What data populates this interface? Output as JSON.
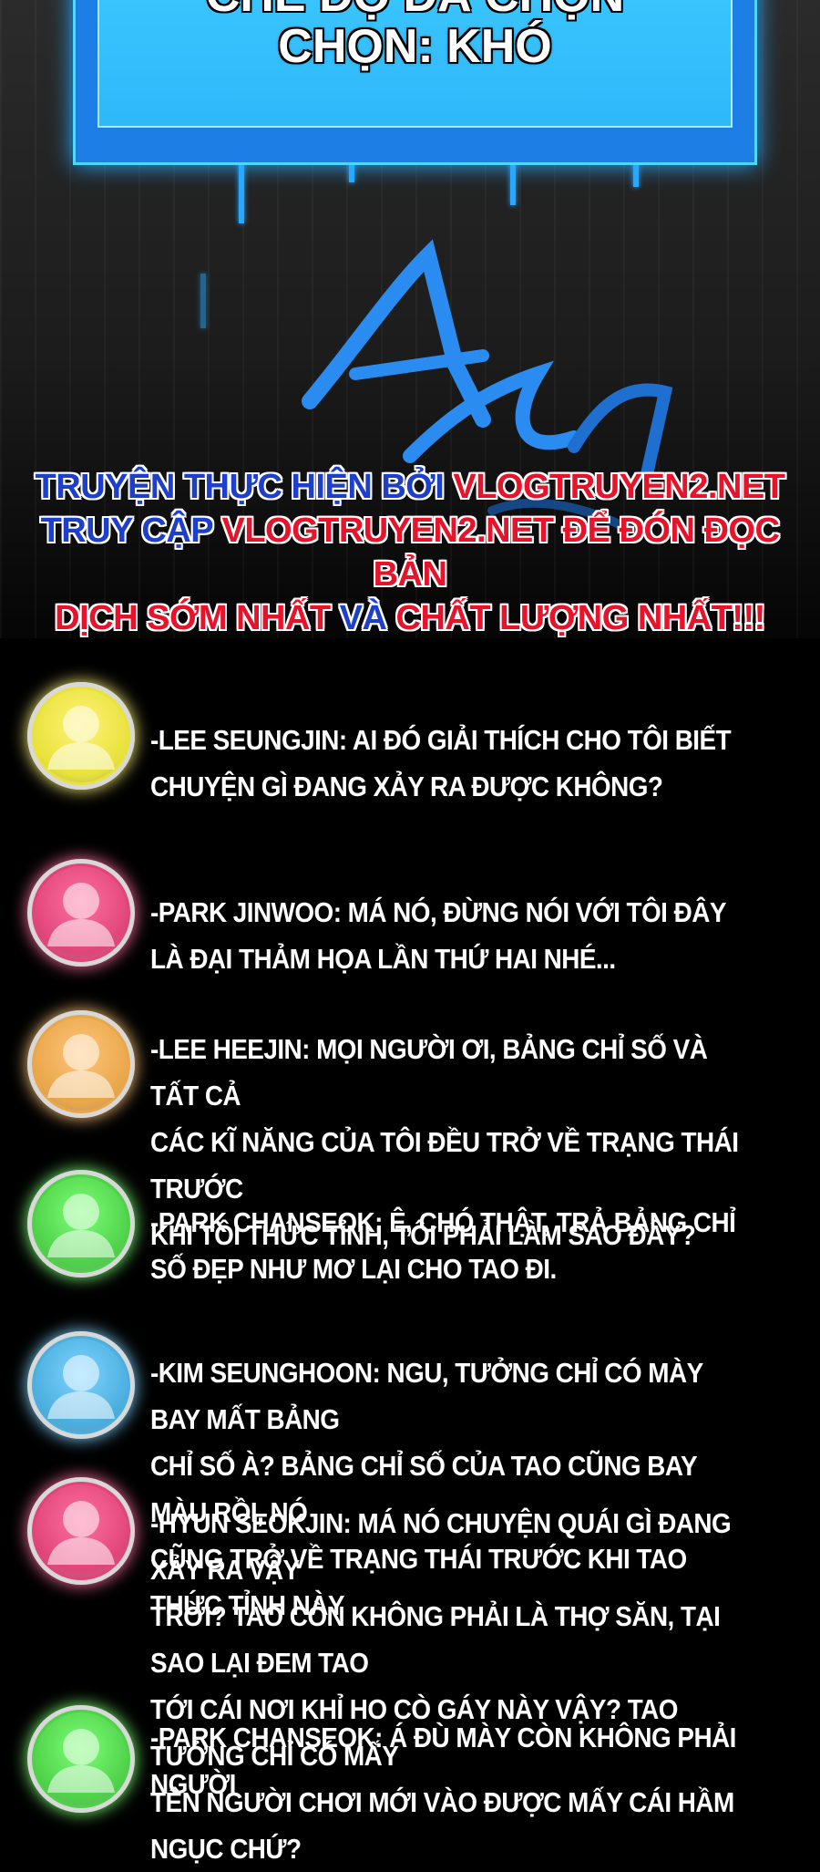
{
  "hud": {
    "partial_line": "CHẾ ĐỘ ĐÃ CHỌN",
    "title": "CHỌN: KHÓ"
  },
  "watermark": {
    "line1_a": "TRUYỆN THỰC HIỆN BỞI ",
    "line1_b": "VLOGTRUYEN2.NET",
    "line2_a": "TRUY CẬP ",
    "line2_b": "VLOGTRUYEN2.NET ĐỂ ĐÓN ĐỌC BẢN",
    "line3_a": "DỊCH SỚM NHẤT ",
    "line3_b": "VÀ ",
    "line3_c": "CHẤT LƯỢNG NHẤT!!!"
  },
  "chat": [
    {
      "color": "#e8e23a",
      "glow": "#fff27a",
      "text": "-LEE SEUNGJIN: AI ĐÓ GIẢI THÍCH CHO TÔI BIẾT\nCHUYỆN GÌ ĐANG XẢY RA ĐƯỢC KHÔNG?"
    },
    {
      "color": "#e0457a",
      "glow": "#ff6fa0",
      "text": "-PARK JINWOO: MÁ NÓ, ĐỪNG NÓI VỚI TÔI ĐÂY\nLÀ ĐẠI THẢM HỌA LẦN THỨ HAI NHÉ..."
    },
    {
      "color": "#e9a64a",
      "glow": "#ffc57a",
      "text": "-LEE HEEJIN: MỌI NGƯỜI ƠI, BẢNG CHỈ SỐ VÀ TẤT CẢ\nCÁC KĨ NĂNG CỦA TÔI ĐỀU TRỞ VỀ TRẠNG THÁI TRƯỚC\nKHI TÔI THỨC TỈNH, TÔI PHẢI LÀM SAO ĐÂY?"
    },
    {
      "color": "#4fd14a",
      "glow": "#7cff76",
      "text": "-PARK CHANSEOK: Ê, CHÓ THẬT, TRẢ BẢNG CHỈ\nSỐ ĐẸP NHƯ MƠ LẠI CHO TAO ĐI."
    },
    {
      "color": "#4aaede",
      "glow": "#7fd4ff",
      "text": "-KIM SEUNGHOON: NGU, TƯỞNG CHỈ CÓ MÀY BAY MẤT BẢNG\nCHỈ SỐ À? BẢNG CHỈ SỐ CỦA TAO CŨNG BAY MÀU RỒI, NÓ\nCŨNG TRỞ VỀ TRẠNG THÁI TRƯỚC KHI TAO THỨC TỈNH NÀY"
    },
    {
      "color": "#e0457a",
      "glow": "#ff6fa0",
      "text": "-HYUN SEOKJIN: MÁ NÓ CHUYỆN QUÁI GÌ ĐANG XẢY RA VẬY\nTRỜI? TAO CÒN KHÔNG PHẢI LÀ THỢ SĂN, TẠI SAO LẠI ĐEM TAO\nTỚI CÁI NƠI KHỈ HO CÒ GÁY NÀY VẬY? TAO TƯỞNG CHỈ CÓ MẤY\nTÊN NGƯỜI CHƠI MỚI VÀO ĐƯỢC MẤY CÁI HẦM NGỤC CHỨ?"
    },
    {
      "color": "#4fd14a",
      "glow": "#7cff76",
      "text": "-PARK CHANSEOK: Á ĐÙ MÀY CÒN KHÔNG PHẢI NGƯỜI"
    }
  ]
}
